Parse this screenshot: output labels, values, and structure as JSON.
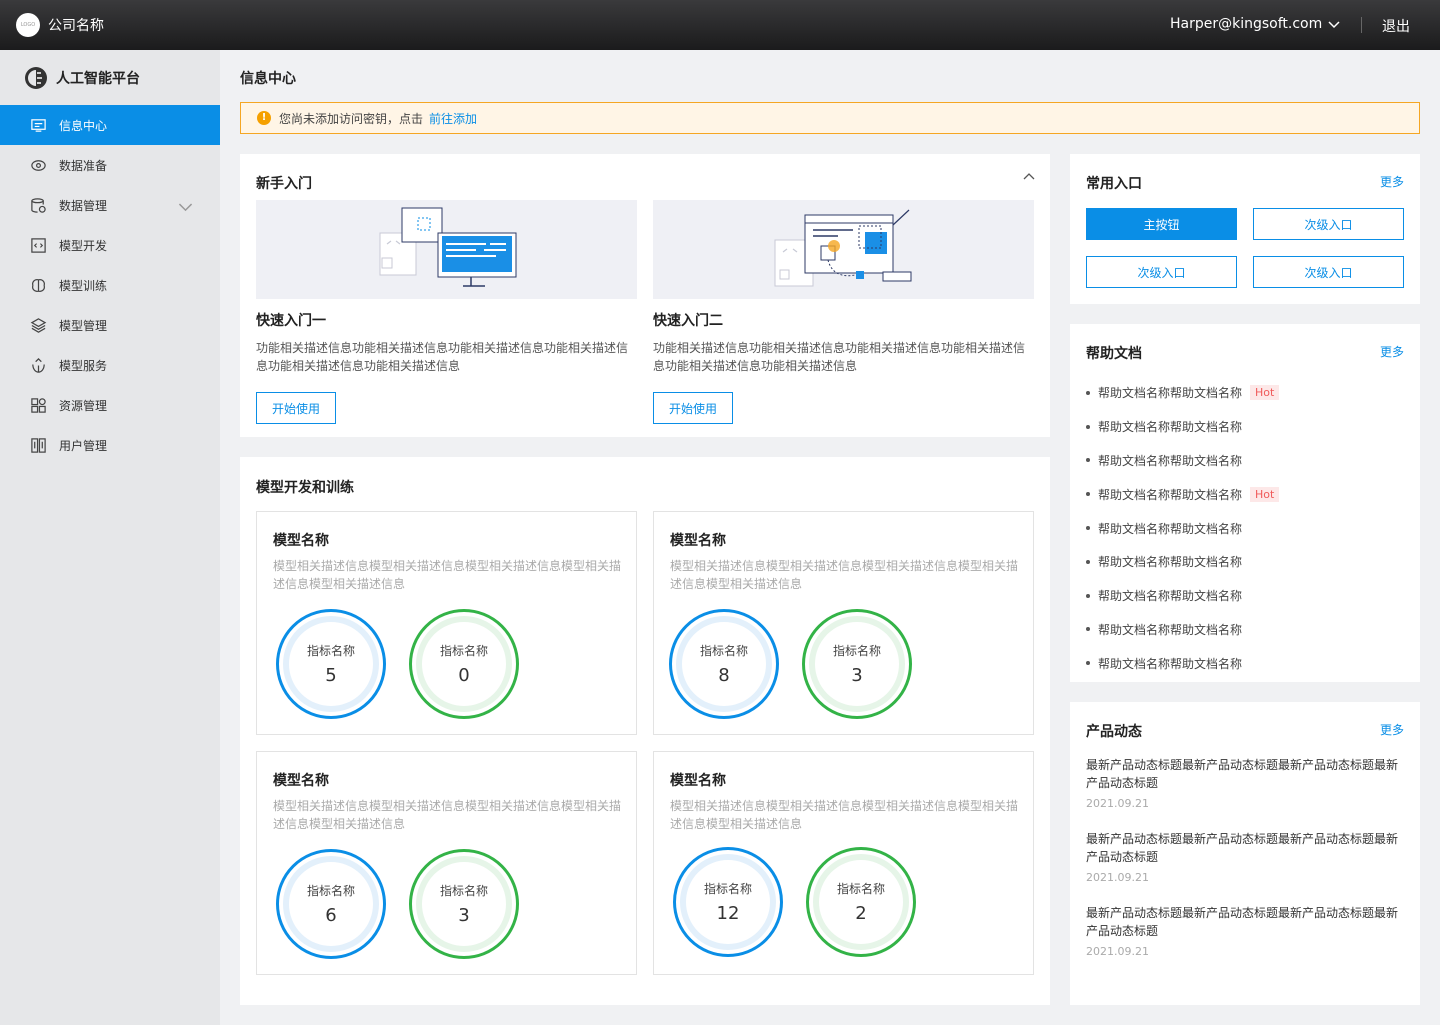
{
  "header": {
    "logo_text": "LOGO",
    "company": "公司名称",
    "user_email": "Harper@kingsoft.com",
    "logout": "退出"
  },
  "sidebar": {
    "platform": "人工智能平台",
    "items": [
      {
        "label": "信息中心",
        "icon": "info-center-icon",
        "active": true
      },
      {
        "label": "数据准备",
        "icon": "data-prep-icon"
      },
      {
        "label": "数据管理",
        "icon": "data-manage-icon",
        "expandable": true
      },
      {
        "label": "模型开发",
        "icon": "code-icon"
      },
      {
        "label": "模型训练",
        "icon": "brain-icon"
      },
      {
        "label": "模型管理",
        "icon": "layers-icon"
      },
      {
        "label": "模型服务",
        "icon": "service-icon"
      },
      {
        "label": "资源管理",
        "icon": "resource-icon"
      },
      {
        "label": "用户管理",
        "icon": "user-manage-icon"
      }
    ]
  },
  "main": {
    "page_title": "信息中心",
    "alert": {
      "text": "您尚未添加访问密钥，点击",
      "link": "前往添加"
    },
    "getting_started": {
      "title": "新手入门",
      "items": [
        {
          "name": "快速入门一",
          "desc": "功能相关描述信息功能相关描述信息功能相关描述信息功能相关描述信息功能相关描述信息功能相关描述信息",
          "button": "开始使用"
        },
        {
          "name": "快速入门二",
          "desc": "功能相关描述信息功能相关描述信息功能相关描述信息功能相关描述信息功能相关描述信息功能相关描述信息",
          "button": "开始使用"
        }
      ]
    },
    "model_dev": {
      "title": "模型开发和训练",
      "models": [
        {
          "name": "模型名称",
          "desc": "模型相关描述信息模型相关描述信息模型相关描述信息模型相关描述信息模型相关描述信息",
          "metrics": [
            {
              "label": "指标名称",
              "value": "5"
            },
            {
              "label": "指标名称",
              "value": "0"
            }
          ]
        },
        {
          "name": "模型名称",
          "desc": "模型相关描述信息模型相关描述信息模型相关描述信息模型相关描述信息模型相关描述信息",
          "metrics": [
            {
              "label": "指标名称",
              "value": "8"
            },
            {
              "label": "指标名称",
              "value": "3"
            }
          ]
        },
        {
          "name": "模型名称",
          "desc": "模型相关描述信息模型相关描述信息模型相关描述信息模型相关描述信息模型相关描述信息",
          "metrics": [
            {
              "label": "指标名称",
              "value": "6"
            },
            {
              "label": "指标名称",
              "value": "3"
            }
          ]
        },
        {
          "name": "模型名称",
          "desc": "模型相关描述信息模型相关描述信息模型相关描述信息模型相关描述信息模型相关描述信息",
          "metrics": [
            {
              "label": "指标名称",
              "value": "12"
            },
            {
              "label": "指标名称",
              "value": "2"
            }
          ]
        }
      ]
    }
  },
  "quick_entry": {
    "title": "常用入口",
    "more": "更多",
    "buttons": [
      "主按钮",
      "次级入口",
      "次级入口",
      "次级入口"
    ]
  },
  "help_docs": {
    "title": "帮助文档",
    "more": "更多",
    "items": [
      {
        "label": "帮助文档名称帮助文档名称",
        "badge": "Hot"
      },
      {
        "label": "帮助文档名称帮助文档名称"
      },
      {
        "label": "帮助文档名称帮助文档名称"
      },
      {
        "label": "帮助文档名称帮助文档名称",
        "badge": "Hot"
      },
      {
        "label": "帮助文档名称帮助文档名称"
      },
      {
        "label": "帮助文档名称帮助文档名称"
      },
      {
        "label": "帮助文档名称帮助文档名称"
      },
      {
        "label": "帮助文档名称帮助文档名称"
      },
      {
        "label": "帮助文档名称帮助文档名称"
      }
    ]
  },
  "news": {
    "title": "产品动态",
    "more": "更多",
    "items": [
      {
        "title": "最新产品动态标题最新产品动态标题最新产品动态标题最新产品动态标题",
        "date": "2021.09.21"
      },
      {
        "title": "最新产品动态标题最新产品动态标题最新产品动态标题最新产品动态标题",
        "date": "2021.09.21"
      },
      {
        "title": "最新产品动态标题最新产品动态标题最新产品动态标题最新产品动态标题",
        "date": "2021.09.21"
      }
    ]
  },
  "colors": {
    "primary": "#0a8ee6",
    "success": "#33b347",
    "warning": "#f5a623",
    "hot": "#f05a5a"
  }
}
